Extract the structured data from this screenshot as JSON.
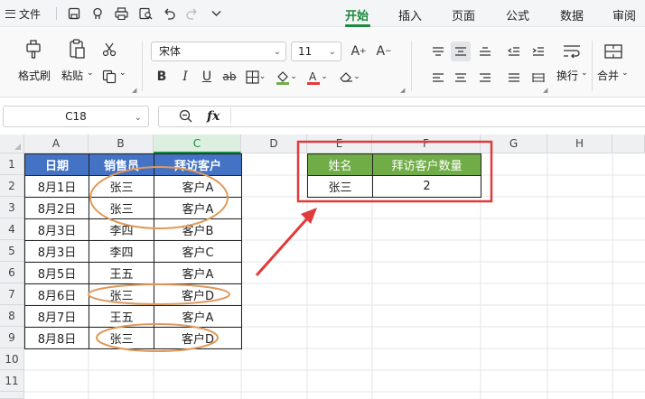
{
  "menu": {
    "file_label": "文件",
    "tabs": [
      "开始",
      "插入",
      "页面",
      "公式",
      "数据",
      "审阅"
    ],
    "active_tab": "开始"
  },
  "ribbon": {
    "format_painter_label": "格式刷",
    "paste_label": "粘贴",
    "font_name": "宋体",
    "font_size": "11",
    "wrap_label": "换行",
    "merge_label": "合并"
  },
  "formula_bar": {
    "name_box": "C18",
    "fx_label": "fx",
    "formula": ""
  },
  "sheet": {
    "columns": [
      "A",
      "B",
      "C",
      "D",
      "E",
      "F",
      "G",
      "H"
    ],
    "selected_column": "C",
    "rows": [
      "1",
      "2",
      "3",
      "4",
      "5",
      "6",
      "7",
      "8",
      "9",
      "10",
      "11"
    ],
    "source_table": {
      "headers": [
        "日期",
        "销售员",
        "拜访客户"
      ],
      "rows": [
        [
          "8月1日",
          "张三",
          "客户A"
        ],
        [
          "8月2日",
          "张三",
          "客户A"
        ],
        [
          "8月3日",
          "李四",
          "客户B"
        ],
        [
          "8月3日",
          "李四",
          "客户C"
        ],
        [
          "8月5日",
          "王五",
          "客户A"
        ],
        [
          "8月6日",
          "张三",
          "客户D"
        ],
        [
          "8月7日",
          "王五",
          "客户A"
        ],
        [
          "8月8日",
          "张三",
          "客户D"
        ]
      ]
    },
    "result_table": {
      "headers": [
        "姓名",
        "拜访客户数量"
      ],
      "rows": [
        [
          "张三",
          "2"
        ]
      ]
    }
  },
  "colors": {
    "accent": "#1a8a3c",
    "source_header_bg": "#4472c4",
    "result_header_bg": "#70ad47",
    "annotation_circle": "#e0995a",
    "annotation_red": "#e03a3a"
  }
}
